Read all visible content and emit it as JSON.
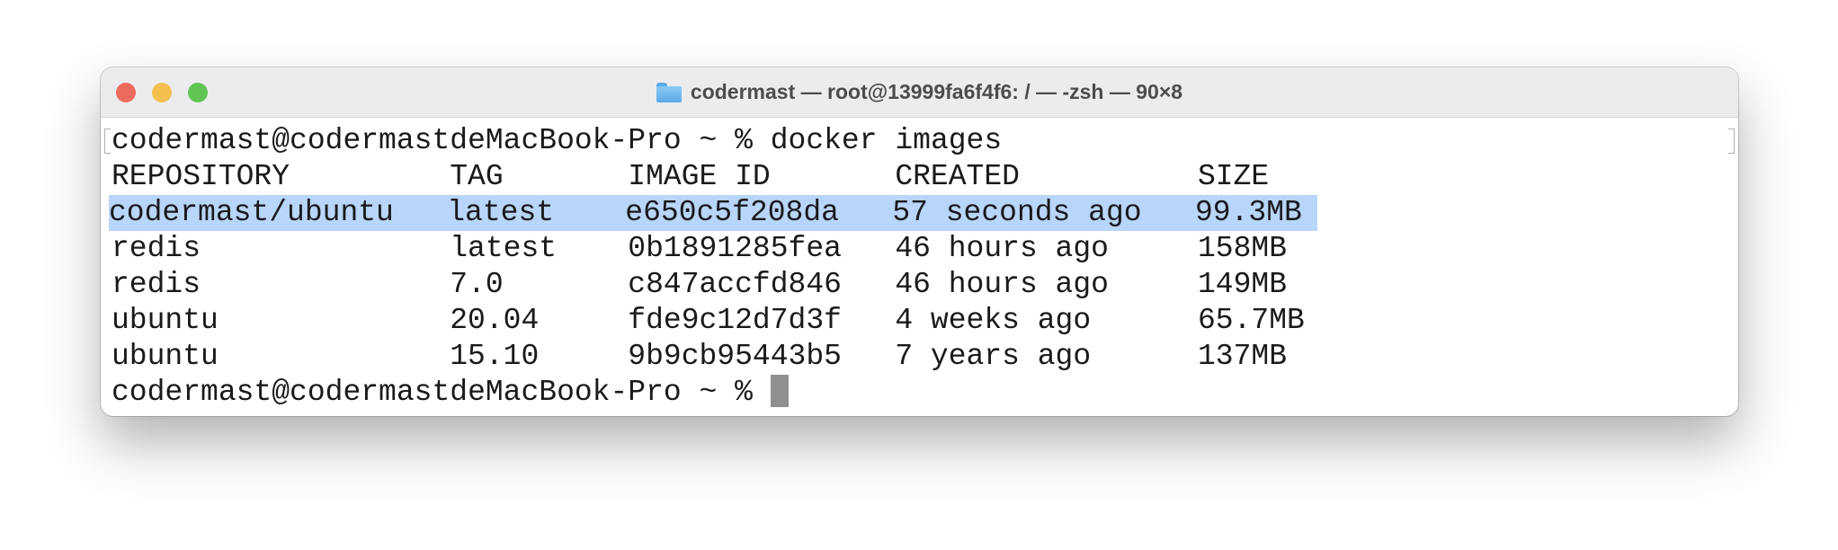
{
  "window": {
    "title": "codermast — root@13999fa6f4f6: / — -zsh — 90×8",
    "traffic_lights": {
      "close": "#ed6a5e",
      "minimize": "#f5bf4f",
      "zoom": "#61c554"
    },
    "title_icon": "folder-icon"
  },
  "terminal": {
    "command_line": "codermast@codermastdeMacBook-Pro ~ % docker images",
    "headers": [
      "REPOSITORY",
      "TAG",
      "IMAGE ID",
      "CREATED",
      "SIZE"
    ],
    "rows": [
      [
        "codermast/ubuntu",
        "latest",
        "e650c5f208da",
        "57 seconds ago",
        "99.3MB"
      ],
      [
        "redis",
        "latest",
        "0b1891285fea",
        "46 hours ago",
        "158MB"
      ],
      [
        "redis",
        "7.0",
        "c847accfd846",
        "46 hours ago",
        "149MB"
      ],
      [
        "ubuntu",
        "20.04",
        "fde9c12d7d3f",
        "4 weeks ago",
        "65.7MB"
      ],
      [
        "ubuntu",
        "15.10",
        "9b9cb95443b5",
        "7 years ago",
        "137MB"
      ]
    ],
    "selected_row": 0,
    "selection_color": "#b8d5fb",
    "prompt": "codermast@codermastdeMacBook-Pro ~ % "
  }
}
